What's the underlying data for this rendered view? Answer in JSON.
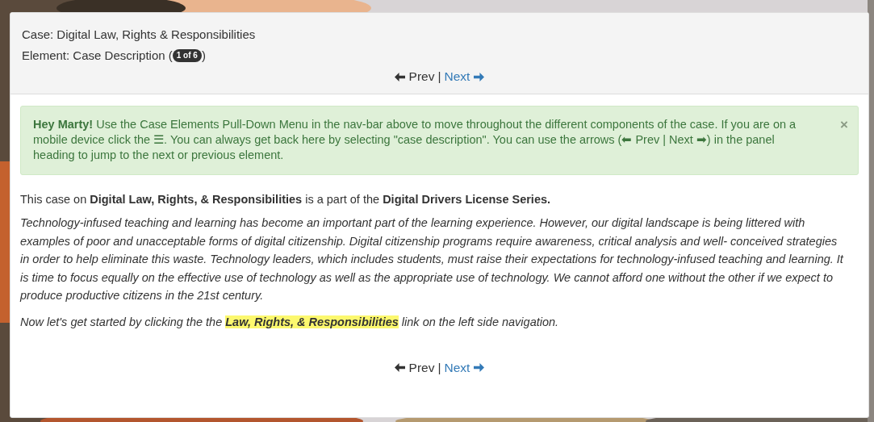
{
  "heading": {
    "case_line": "Case: Digital Law, Rights & Responsibilities",
    "element_label": "Element: Case Description (",
    "element_badge": "1 of 6",
    "element_close": ")"
  },
  "nav_top": {
    "prev": {
      "label": "Prev",
      "disabled": true
    },
    "separator": "|",
    "next": {
      "label": "Next",
      "disabled": false
    }
  },
  "alert": {
    "text": "**Hey Marty!** Use the Case Elements Pull-Down Menu in the nav-bar above to move throughout the different components of the case. If you are on a mobile device click the ☰. You can always get back here by selecting \"case description\". You can use the arrows (⬅ Prev | Next ➡) in the panel heading to jump to the next or previous element.",
    "close": "×"
  },
  "intro": "This case on **Digital Law, Rights, & Responsibilities** is a part of the **Digital Drivers License Series.**",
  "description": "Technology-infused teaching and learning has become an important part of the learning experience. However, our digital landscape is being littered with examples of poor and unacceptable forms of digital citizenship. Digital citizenship programs require awareness, critical analysis and well- conceived strategies in order to help eliminate this waste. Technology leaders, which includes students, must raise their expectations for technology-infused teaching and learning. It is time to focus equally on the effective use of technology as well as the appropriate use of technology. We cannot afford one without the other if we expect to produce productive citizens in the 21st century.",
  "start": {
    "before": "Now let's get started by clicking the the ",
    "link": "Law, Rights, & Responsibilities",
    "after": " link on the left side navigation."
  },
  "nav_bottom": {
    "prev": {
      "label": "Prev",
      "disabled": true
    },
    "separator": "|",
    "next": {
      "label": "Next",
      "disabled": false
    }
  }
}
